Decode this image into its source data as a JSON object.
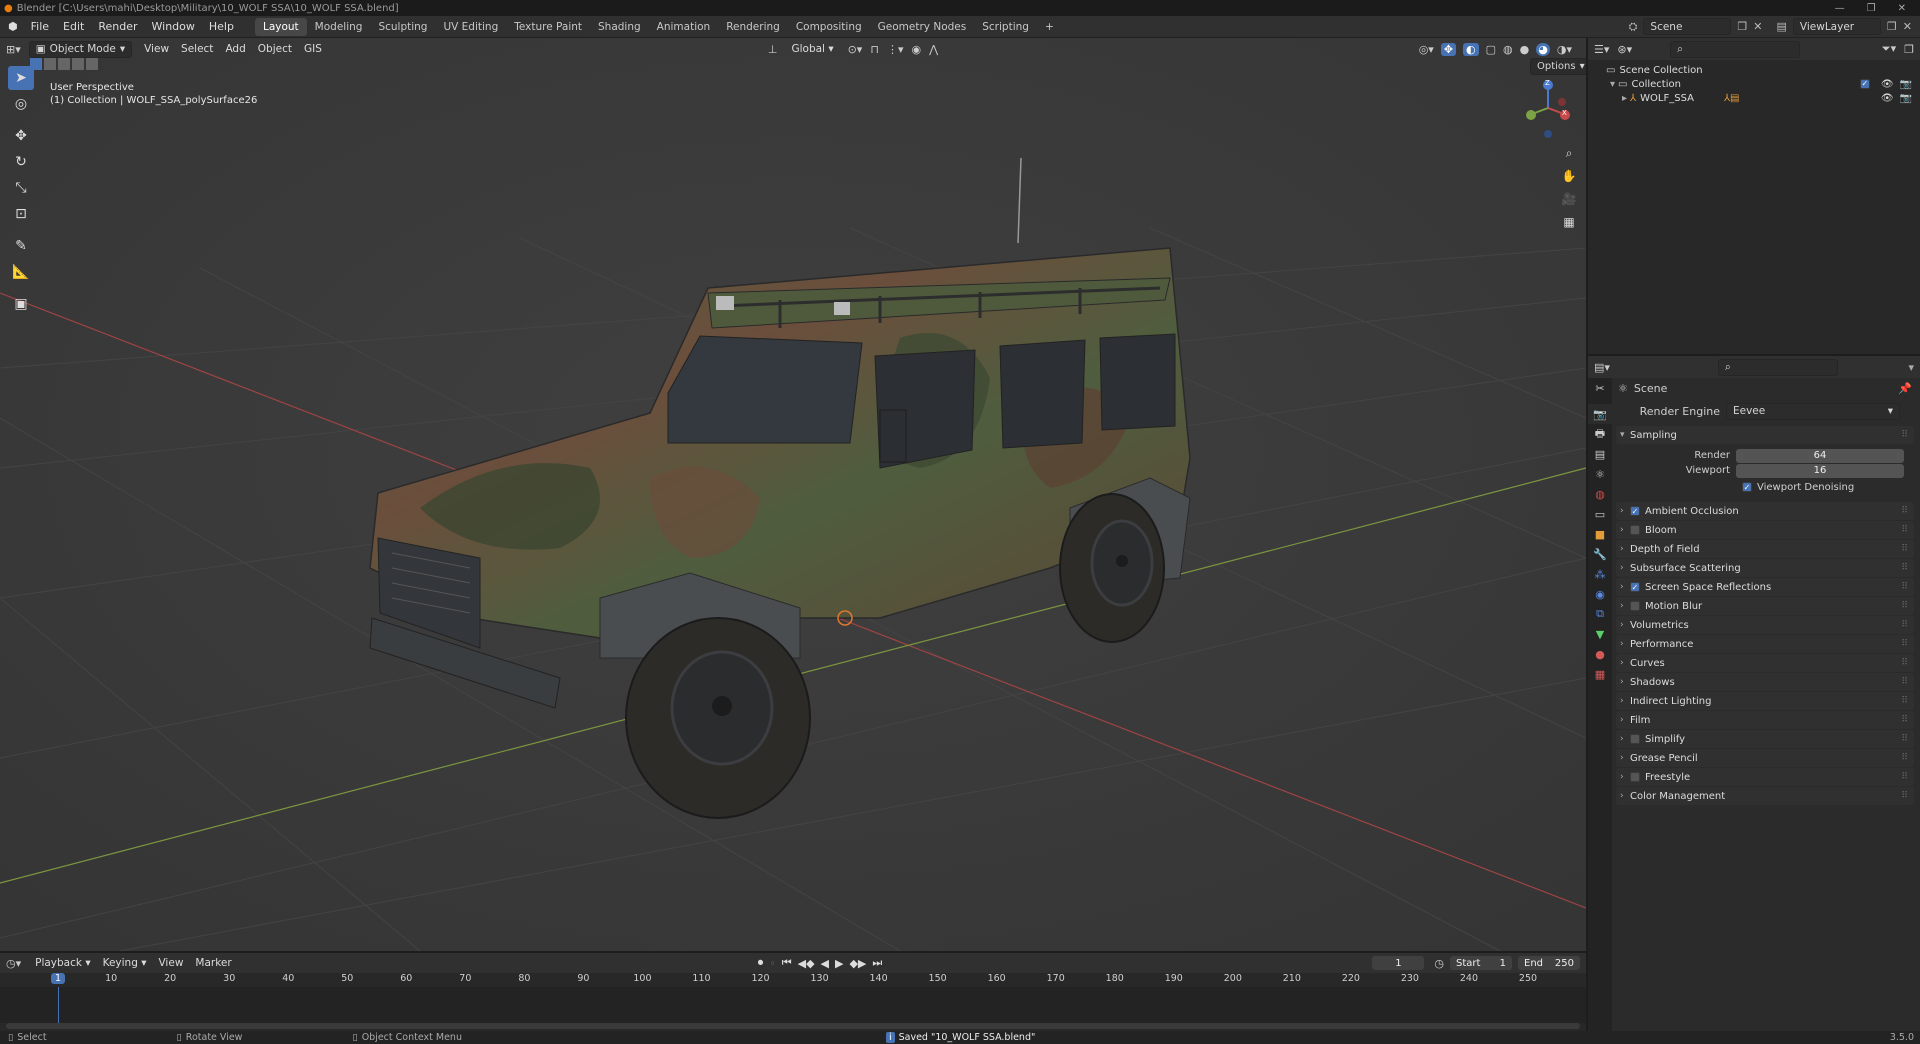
{
  "window": {
    "title": "Blender [C:\\Users\\mahi\\Desktop\\Military\\10_WOLF SSA\\10_WOLF SSA.blend]"
  },
  "menu": {
    "items": [
      "File",
      "Edit",
      "Render",
      "Window",
      "Help"
    ]
  },
  "workspaces": {
    "tabs": [
      "Layout",
      "Modeling",
      "Sculpting",
      "UV Editing",
      "Texture Paint",
      "Shading",
      "Animation",
      "Rendering",
      "Compositing",
      "Geometry Nodes",
      "Scripting"
    ],
    "active": "Layout",
    "add": "+"
  },
  "topbar_right": {
    "scene": "Scene",
    "view_layer": "ViewLayer"
  },
  "viewport": {
    "mode": "Object Mode",
    "menu": [
      "View",
      "Select",
      "Add",
      "Object",
      "GIS"
    ],
    "transform_orientation": "Global",
    "options_label": "Options",
    "overlay_line1": "User Perspective",
    "overlay_line2": "(1) Collection | WOLF_SSA_polySurface26",
    "gizmo": {
      "z": "Z",
      "x": "X"
    }
  },
  "outliner": {
    "scene_collection": "Scene Collection",
    "collection": "Collection",
    "object": "WOLF_SSA"
  },
  "properties": {
    "context": "Scene",
    "render_engine_label": "Render Engine",
    "render_engine": "Eevee",
    "sampling": {
      "label": "Sampling",
      "render_label": "Render",
      "render_value": "64",
      "viewport_label": "Viewport",
      "viewport_value": "16",
      "denoise_label": "Viewport Denoising",
      "denoise_checked": true
    },
    "panels": [
      {
        "label": "Ambient Occlusion",
        "checkbox": true,
        "checked": true
      },
      {
        "label": "Bloom",
        "checkbox": true,
        "checked": false
      },
      {
        "label": "Depth of Field",
        "checkbox": false
      },
      {
        "label": "Subsurface Scattering",
        "checkbox": false
      },
      {
        "label": "Screen Space Reflections",
        "checkbox": true,
        "checked": true
      },
      {
        "label": "Motion Blur",
        "checkbox": true,
        "checked": false
      },
      {
        "label": "Volumetrics",
        "checkbox": false
      },
      {
        "label": "Performance",
        "checkbox": false
      },
      {
        "label": "Curves",
        "checkbox": false
      },
      {
        "label": "Shadows",
        "checkbox": false
      },
      {
        "label": "Indirect Lighting",
        "checkbox": false
      },
      {
        "label": "Film",
        "checkbox": false
      },
      {
        "label": "Simplify",
        "checkbox": true,
        "checked": false
      },
      {
        "label": "Grease Pencil",
        "checkbox": false
      },
      {
        "label": "Freestyle",
        "checkbox": true,
        "checked": false
      },
      {
        "label": "Color Management",
        "checkbox": false
      }
    ]
  },
  "timeline": {
    "menu": [
      "Playback",
      "Keying",
      "View",
      "Marker"
    ],
    "current_frame": "1",
    "start_label": "Start",
    "start": "1",
    "end_label": "End",
    "end": "250",
    "ticks": [
      "1",
      "10",
      "20",
      "30",
      "40",
      "50",
      "60",
      "70",
      "80",
      "90",
      "100",
      "110",
      "120",
      "130",
      "140",
      "150",
      "160",
      "170",
      "180",
      "190",
      "200",
      "210",
      "220",
      "230",
      "240",
      "250"
    ]
  },
  "statusbar": {
    "select": "Select",
    "rotate": "Rotate View",
    "context_menu": "Object Context Menu",
    "message": "Saved \"10_WOLF SSA.blend\"",
    "version": "3.5.0"
  },
  "colors": {
    "accent": "#4772b3",
    "viewport_bg": "#3a3a3a",
    "x_axis": "#b0413e",
    "y_axis": "#7a9a3a",
    "camo_green": "#4d5a3a",
    "camo_brown": "#6a4a38"
  }
}
